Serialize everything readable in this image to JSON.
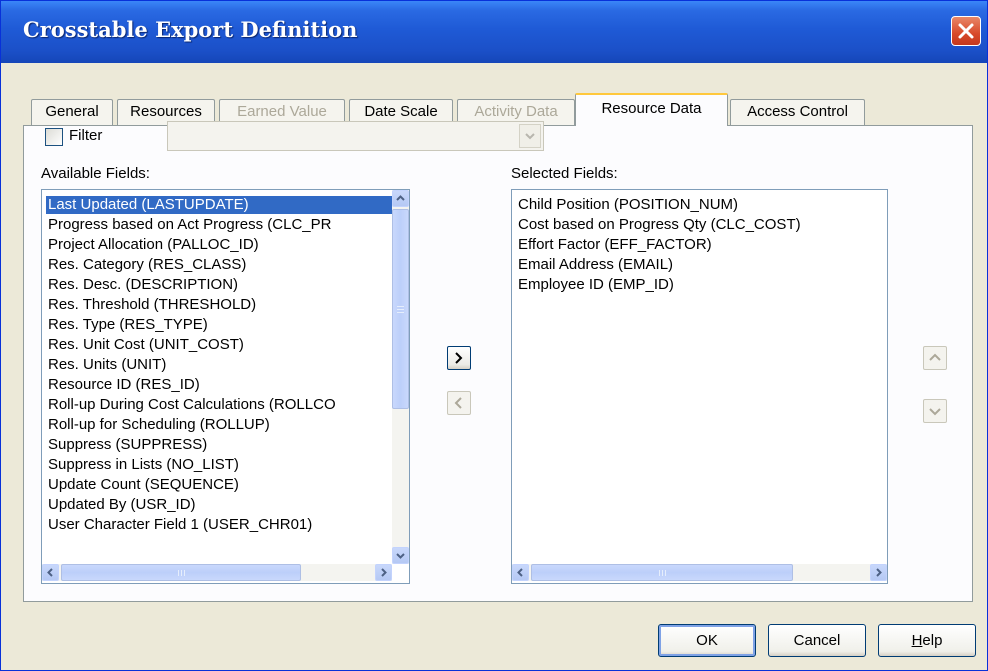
{
  "window": {
    "title": "Crosstable Export Definition"
  },
  "tabs": [
    {
      "label": "General",
      "state": "normal"
    },
    {
      "label": "Resources",
      "state": "normal"
    },
    {
      "label": "Earned Value",
      "state": "disabled"
    },
    {
      "label": "Date Scale",
      "state": "normal"
    },
    {
      "label": "Activity Data",
      "state": "disabled"
    },
    {
      "label": "Resource Data",
      "state": "active"
    },
    {
      "label": "Access Control",
      "state": "normal"
    }
  ],
  "filter": {
    "label": "Filter",
    "checked": false,
    "value": ""
  },
  "available": {
    "label": "Available Fields:",
    "selected_item": "Last Updated (LASTUPDATE)",
    "items": [
      "Last Updated (LASTUPDATE)",
      "Progress based on Act Progress (CLC_PR",
      "Project Allocation (PALLOC_ID)",
      "Res. Category (RES_CLASS)",
      "Res. Desc. (DESCRIPTION)",
      "Res. Threshold (THRESHOLD)",
      "Res. Type (RES_TYPE)",
      "Res. Unit Cost (UNIT_COST)",
      "Res. Units (UNIT)",
      "Resource ID (RES_ID)",
      "Roll-up During Cost Calculations (ROLLCO",
      "Roll-up for Scheduling (ROLLUP)",
      "Suppress (SUPPRESS)",
      "Suppress in Lists (NO_LIST)",
      "Update Count (SEQUENCE)",
      "Updated By (USR_ID)",
      "User Character Field 1 (USER_CHR01)"
    ]
  },
  "selected": {
    "label": "Selected Fields:",
    "items": [
      "Child Position (POSITION_NUM)",
      "Cost based on Progress Qty (CLC_COST)",
      "Effort Factor (EFF_FACTOR)",
      "Email Address (EMAIL)",
      "Employee ID (EMP_ID)"
    ]
  },
  "buttons": {
    "ok": "OK",
    "cancel": "Cancel",
    "help": "Help",
    "help_mnemonic": "H",
    "help_rest": "elp"
  },
  "icons": {
    "close": "close-icon",
    "add": "chevron-right-icon",
    "remove": "chevron-left-icon",
    "up": "chevron-up-icon",
    "down": "chevron-down-icon"
  },
  "colors": {
    "titlebar": "#1f5ad6",
    "selection": "#316ac5",
    "active_tab_accent": "#ffc83c",
    "close_button": "#d8492a"
  }
}
